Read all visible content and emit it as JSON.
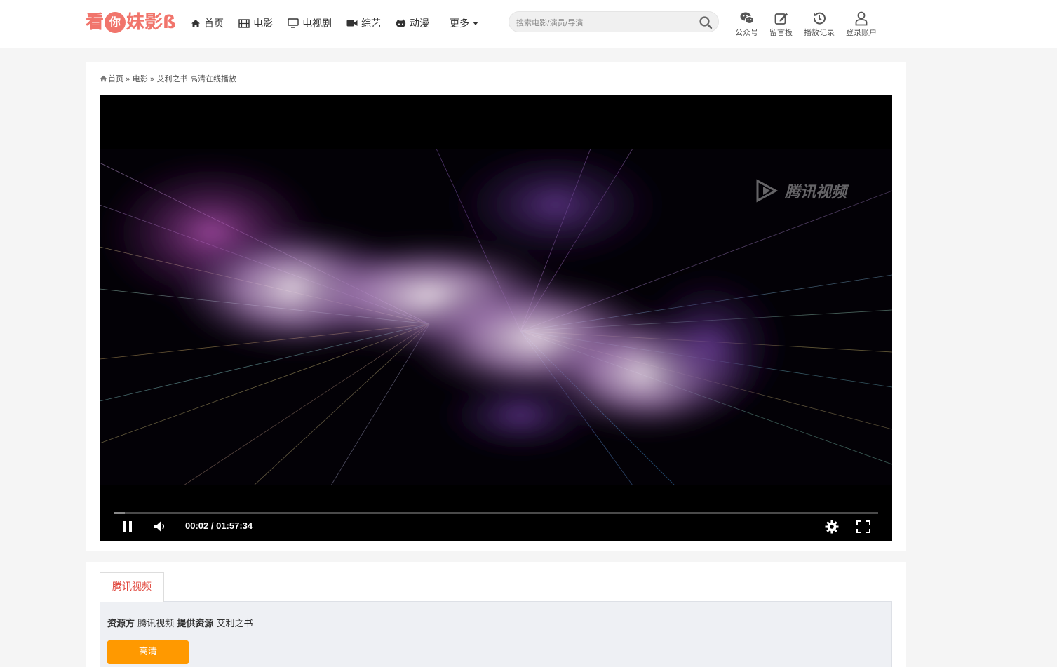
{
  "header": {
    "logo": [
      "看",
      "你",
      "妹",
      "影",
      "ß"
    ],
    "nav": [
      {
        "label": "首页",
        "icon": "home-icon"
      },
      {
        "label": "电影",
        "icon": "film-icon"
      },
      {
        "label": "电视剧",
        "icon": "tv-icon"
      },
      {
        "label": "综艺",
        "icon": "video-camera-icon"
      },
      {
        "label": "动漫",
        "icon": "github-cat-icon"
      },
      {
        "label": "更多",
        "icon": "caret-down-icon"
      }
    ],
    "search": {
      "placeholder": "搜索电影/演员/导演"
    },
    "tools": [
      {
        "label": "公众号",
        "icon": "wechat-icon"
      },
      {
        "label": "留言板",
        "icon": "edit-icon"
      },
      {
        "label": "播放记录",
        "icon": "history-icon"
      },
      {
        "label": "登录账户",
        "icon": "user-icon"
      }
    ]
  },
  "breadcrumb": {
    "home": "首页",
    "sep": "»",
    "category": "电影",
    "current": "艾利之书 高清在线播放"
  },
  "player": {
    "watermark": "腾讯视频",
    "time": "00:02 / 01:57:34",
    "progress": 0.0003
  },
  "source": {
    "tab": "腾讯视频",
    "label_provider": "资源方",
    "provider": "腾讯视频",
    "label_provides": "提供资源",
    "title": "艾利之书",
    "quality_button": "高清"
  },
  "colors": {
    "brand": "#f1756c",
    "tab_active": "#e0443a",
    "quality_button": "#ff9900"
  }
}
